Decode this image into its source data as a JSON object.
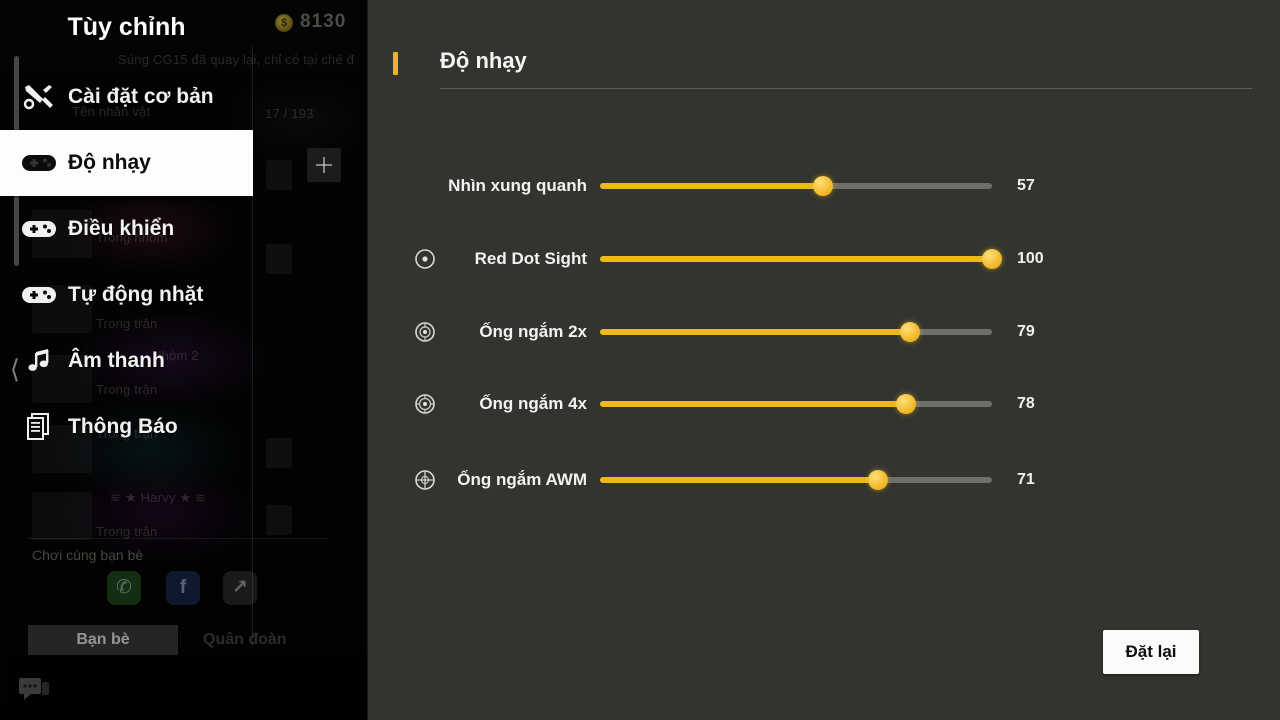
{
  "window": {
    "overlay_title": "Tùy chỉnh",
    "currency_value": "8130",
    "currency_icon": "coin-icon",
    "collapse_icon": "chevron-left-icon",
    "add_icon": "plus-icon"
  },
  "background": {
    "ticker": "Súng CG15 đã quay lại, chỉ có tại chế đ",
    "name_field_label": "Tên nhân vật",
    "counter": "17 / 193",
    "ghost_rows": [
      "Trong nhóm",
      "Trong trận",
      "Trong trận",
      "Trong trận",
      "Trong trận"
    ],
    "ghost_names": [
      "Nhóm 2",
      "≋ ★ Harvy ★ ≋"
    ]
  },
  "sidebar": {
    "items": [
      {
        "label": "Cài đặt cơ bản",
        "icon": "tools-icon",
        "active": false
      },
      {
        "label": "Độ nhạy",
        "icon": "gamepad-icon",
        "active": true
      },
      {
        "label": "Điều khiển",
        "icon": "gamepad-icon",
        "active": false
      },
      {
        "label": "Tự động nhặt",
        "icon": "gamepad-icon",
        "active": false
      },
      {
        "label": "Âm thanh",
        "icon": "music-note-icon",
        "active": false
      },
      {
        "label": "Thông Báo",
        "icon": "document-icon",
        "active": false
      }
    ],
    "share": {
      "label": "Chơi cùng bạn bè",
      "buttons": [
        {
          "name": "line-share-button",
          "glyph": "✆"
        },
        {
          "name": "facebook-share-button",
          "glyph": "f"
        },
        {
          "name": "more-share-button",
          "glyph": "↗"
        }
      ]
    },
    "tabs": [
      {
        "label": "Bạn bè",
        "active": true
      },
      {
        "label": "Quân đoàn",
        "active": false
      }
    ],
    "chat_icon": "chat-bubble-icon"
  },
  "main": {
    "title": "Độ nhạy",
    "reset_button": "Đặt lại",
    "slider_max": 100,
    "sliders": [
      {
        "label": "Nhìn xung quanh",
        "value": 57,
        "icon": null,
        "value_text": "57"
      },
      {
        "label": "Red Dot Sight",
        "value": 100,
        "icon": "red-dot-scope-icon",
        "value_text": "100"
      },
      {
        "label": "Ống ngắm 2x",
        "value": 79,
        "icon": "scope-2x-icon",
        "value_text": "79"
      },
      {
        "label": "Ống ngắm 4x",
        "value": 78,
        "icon": "scope-4x-icon",
        "value_text": "78"
      },
      {
        "label": "Ống ngắm AWM",
        "value": 71,
        "icon": "scope-awm-icon",
        "value_text": "71"
      }
    ]
  },
  "colors": {
    "accent": "#edb91f",
    "panel_bg": "#32342f",
    "track": "#6e6e6a",
    "text": "#f2f2f2"
  }
}
